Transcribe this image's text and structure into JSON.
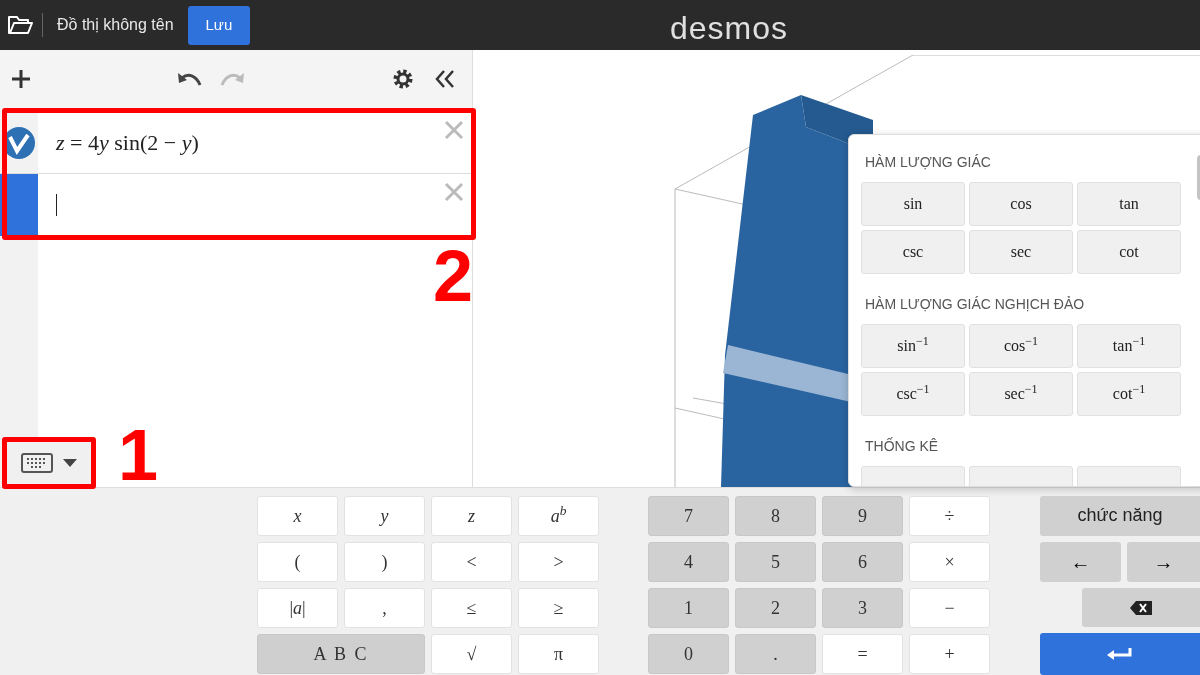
{
  "header": {
    "title": "Đồ thị không tên",
    "save_button": "Lưu",
    "logo": "desmos"
  },
  "expressions": [
    {
      "segments": [
        {
          "text": "z",
          "italic": true
        },
        {
          "text": " = 4",
          "italic": false
        },
        {
          "text": "y",
          "italic": true
        },
        {
          "text": " sin(2 − ",
          "italic": false
        },
        {
          "text": "y",
          "italic": true
        },
        {
          "text": ")",
          "italic": false
        }
      ],
      "selected": false,
      "kind": "graph"
    },
    {
      "selected": true,
      "kind": "empty"
    }
  ],
  "keyboard_toggle": {
    "open": true
  },
  "annotations": [
    {
      "label": "2",
      "kind": "expressions"
    },
    {
      "label": "1",
      "kind": "keyboard"
    }
  ],
  "functions_popup": {
    "sections": [
      {
        "title": "HÀM LƯỢNG GIÁC",
        "keys": [
          "sin",
          "cos",
          "tan",
          "csc",
          "sec",
          "cot"
        ]
      },
      {
        "title": "HÀM LƯỢNG GIÁC NGHỊCH ĐẢO",
        "keys": [
          "sin$^{−1}$",
          "cos$^{−1}$",
          "tan$^{−1}$",
          "csc$^{−1}$",
          "sec$^{−1}$",
          "cot$^{−1}$"
        ]
      },
      {
        "title": "THỐNG KÊ"
      }
    ]
  },
  "keypad": {
    "letters": [
      {
        "label": "*x*",
        "kind": "light"
      },
      {
        "label": "*y*",
        "kind": "light"
      },
      {
        "label": "*z*",
        "kind": "light"
      },
      {
        "label": "*a*$^{b}$",
        "kind": "light"
      },
      {
        "label": "(",
        "kind": "light"
      },
      {
        "label": ")",
        "kind": "light"
      },
      {
        "label": "<",
        "kind": "light"
      },
      {
        "label": ">",
        "kind": "light"
      },
      {
        "label": "|*a*|",
        "kind": "light"
      },
      {
        "label": ",",
        "kind": "light"
      },
      {
        "label": "≤",
        "kind": "light"
      },
      {
        "label": "≥",
        "kind": "light"
      },
      {
        "label": "A B C",
        "kind": "wide"
      },
      {
        "label": "√",
        "kind": "light"
      },
      {
        "label": "π",
        "kind": "light"
      }
    ],
    "numbers": [
      {
        "label": "7",
        "kind": "dark"
      },
      {
        "label": "8",
        "kind": "dark"
      },
      {
        "label": "9",
        "kind": "dark"
      },
      {
        "label": "÷",
        "kind": "light"
      },
      {
        "label": "4",
        "kind": "dark"
      },
      {
        "label": "5",
        "kind": "dark"
      },
      {
        "label": "6",
        "kind": "dark"
      },
      {
        "label": "×",
        "kind": "light"
      },
      {
        "label": "1",
        "kind": "dark"
      },
      {
        "label": "2",
        "kind": "dark"
      },
      {
        "label": "3",
        "kind": "dark"
      },
      {
        "label": "−",
        "kind": "light"
      },
      {
        "label": "0",
        "kind": "dark"
      },
      {
        "label": ".",
        "kind": "dark"
      },
      {
        "label": "=",
        "kind": "light"
      },
      {
        "label": "+",
        "kind": "light"
      }
    ],
    "functions_button": "chức năng",
    "left_arrow": "←",
    "right_arrow": "→"
  }
}
